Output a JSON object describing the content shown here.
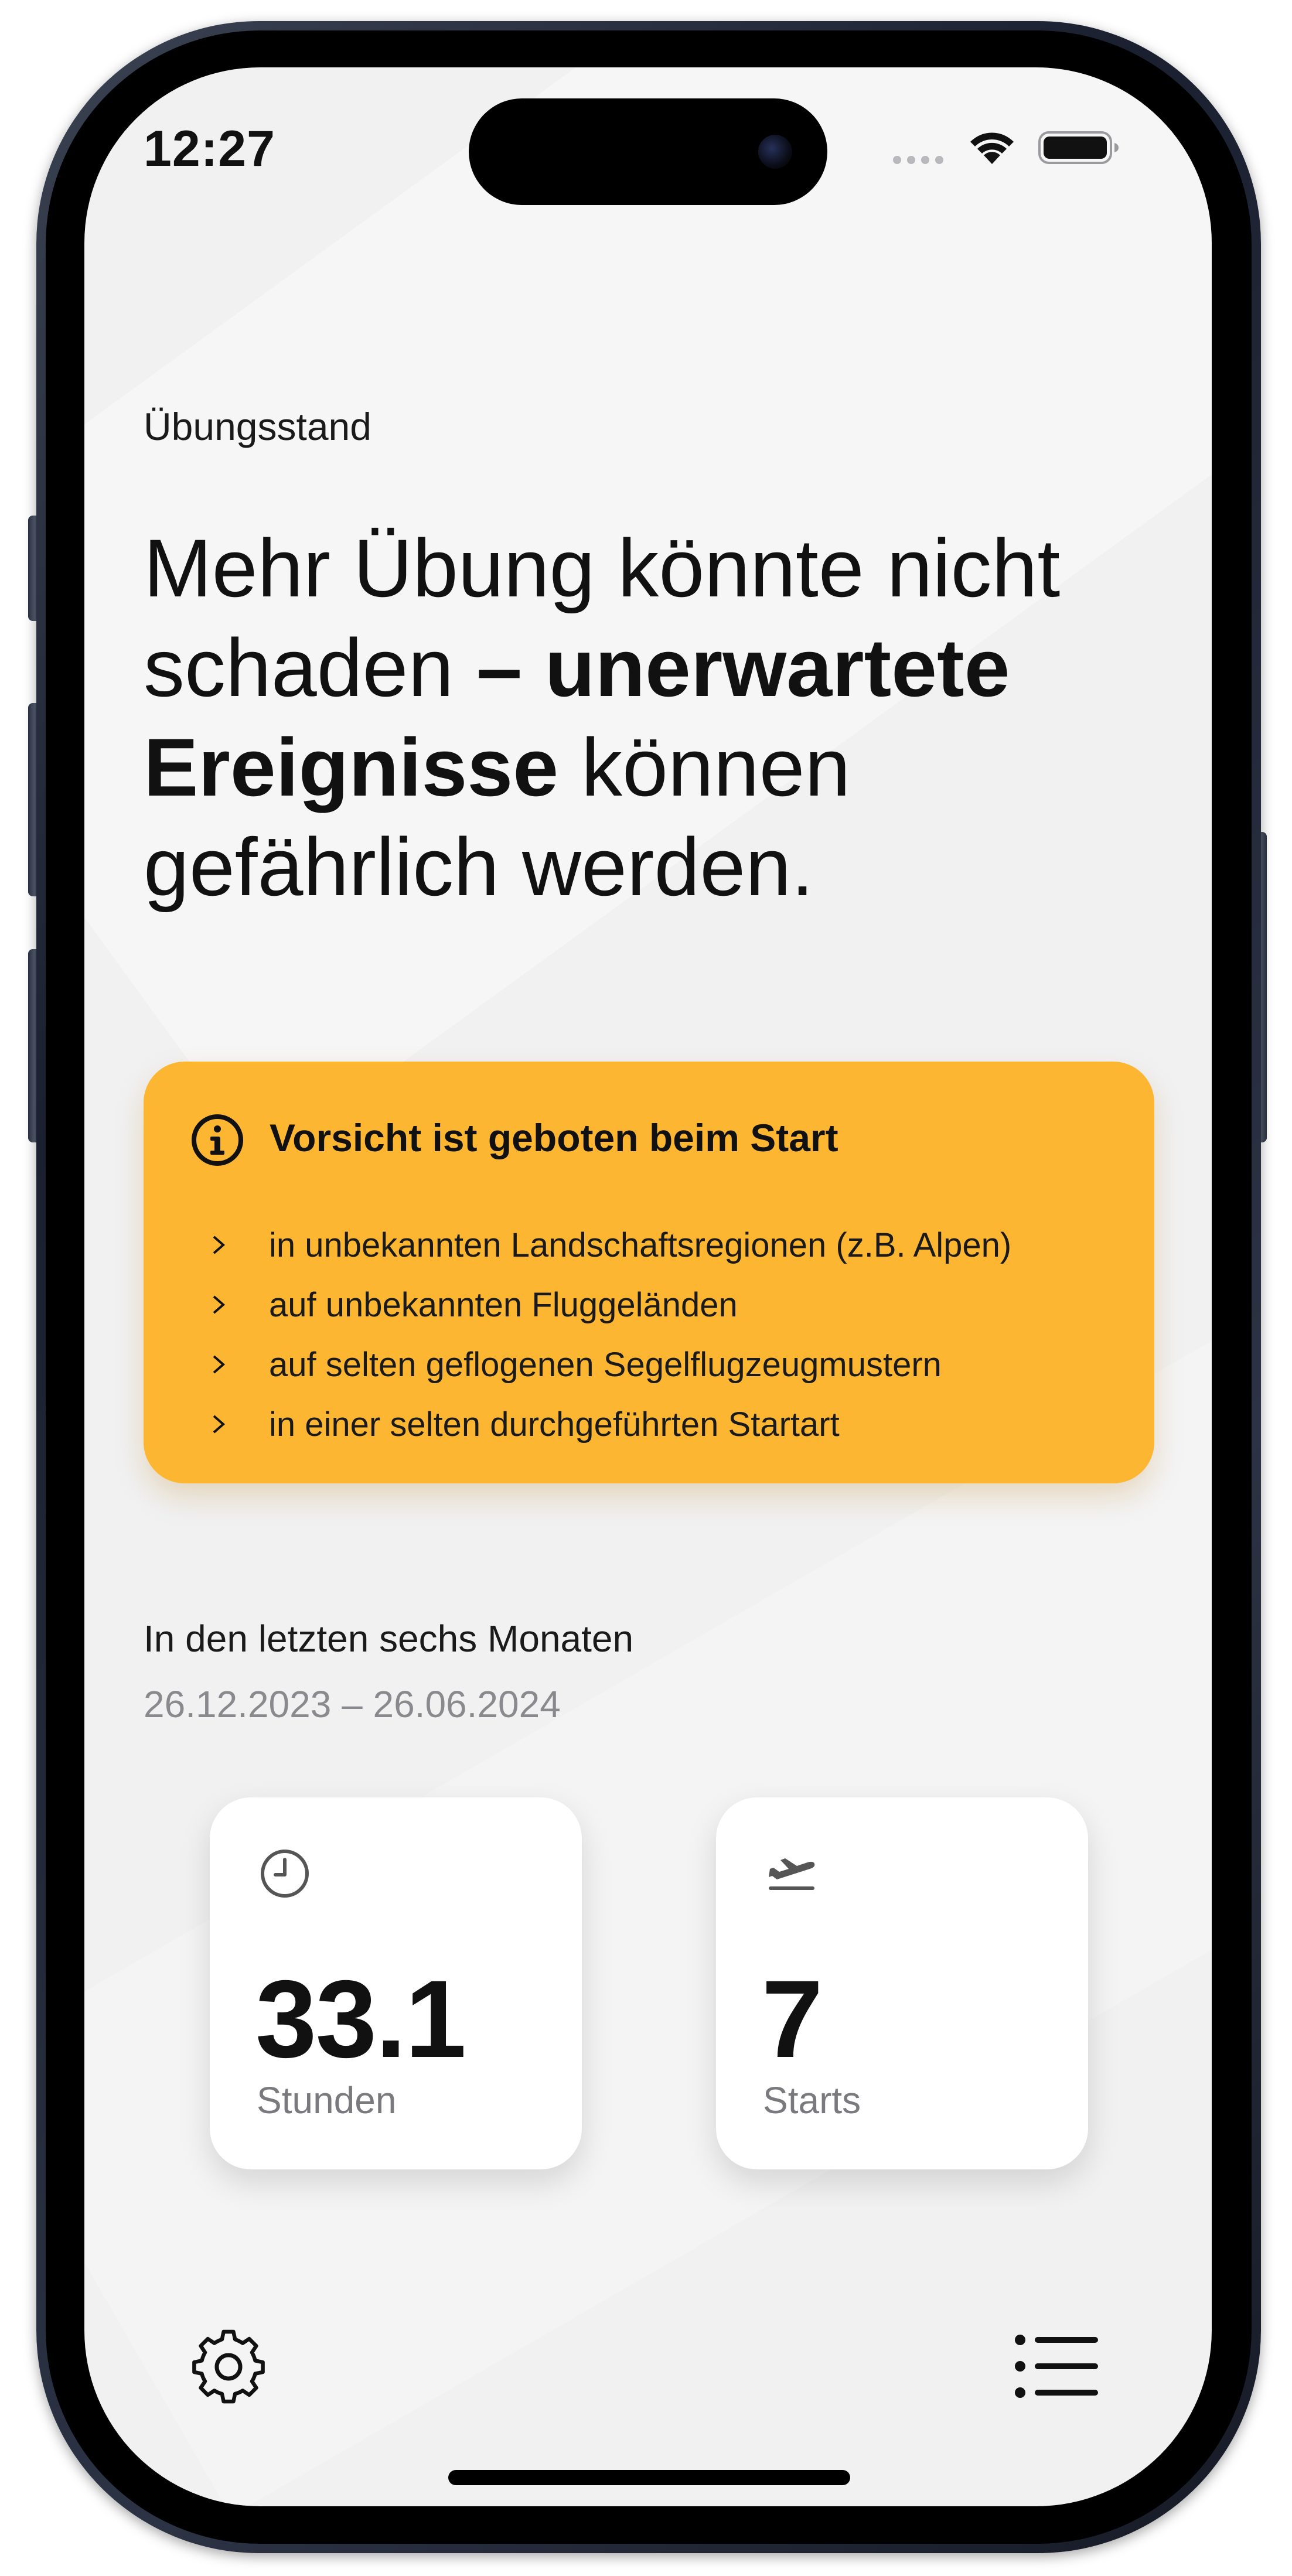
{
  "status_bar": {
    "time": "12:27",
    "icons": [
      "signal-icon",
      "wifi-icon",
      "battery-icon"
    ]
  },
  "eyebrow": "Übungsstand",
  "headline": {
    "part1": "Mehr Übung könnte nicht schaden ",
    "bold1": "– unerwartete Ereignisse",
    "part2": " können gefährlich werden."
  },
  "warning": {
    "icon": "info-icon",
    "title": "Vorsicht ist geboten beim Start",
    "items": [
      "in unbekannten Landschaftsregionen (z.B. Alpen)",
      "auf unbekannten Fluggeländen",
      "auf selten geflogenen Segelflugzeugmustern",
      "in einer selten durchgeführten Startart"
    ],
    "color": "#fcb631"
  },
  "period": {
    "label": "In den letzten sechs Monaten",
    "range": "26.12.2023 – 26.06.2024"
  },
  "stats": {
    "hours": {
      "icon": "clock-icon",
      "value": "33.1",
      "unit": "Stunden"
    },
    "starts": {
      "icon": "airplane-takeoff-icon",
      "value": "7",
      "unit": "Starts"
    }
  },
  "toolbar": {
    "settings_icon": "gear-icon",
    "list_icon": "list-icon"
  }
}
